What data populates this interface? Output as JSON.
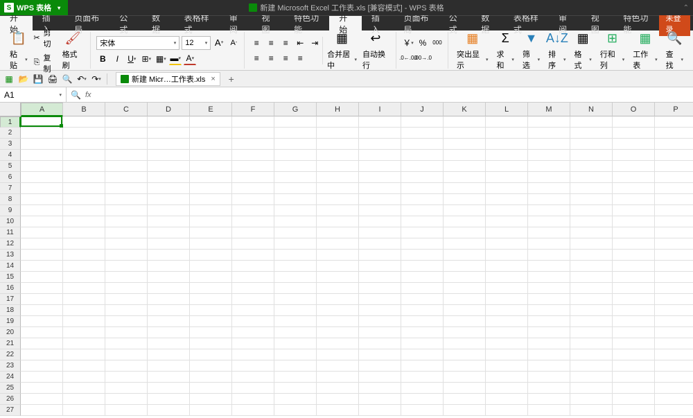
{
  "app": {
    "brand": "WPS 表格",
    "doc_title": "新建 Microsoft Excel 工作表.xls [兼容模式] - WPS 表格"
  },
  "menubar": {
    "items": [
      "开始",
      "插入",
      "页面布局",
      "公式",
      "数据",
      "表格样式",
      "审阅",
      "视图",
      "特色功能"
    ],
    "active_index": 0,
    "login_label": "未登录"
  },
  "ribbon": {
    "paste_label": "粘贴",
    "cut_label": "剪切",
    "copy_label": "复制",
    "brush_label": "格式刷",
    "font_name": "宋体",
    "font_size": "12",
    "merge_center_label": "合并居中",
    "wrap_text_label": "自动换行",
    "currency_symbol": "￥",
    "percent_symbol": "%",
    "comma_symbol": "000",
    "increase_dec": ".0→.00",
    "decrease_dec": ".00→.0",
    "highlight_label": "突出显示",
    "sum_label": "求和",
    "filter_label": "筛选",
    "sort_label": "排序",
    "format_label": "格式",
    "rowcol_label": "行和列",
    "sheet_label": "工作表",
    "find_label": "查找"
  },
  "filetab": {
    "label": "新建 Micr…工作表.xls"
  },
  "formula": {
    "name_box": "A1",
    "fx": "fx"
  },
  "grid": {
    "columns": [
      "A",
      "B",
      "C",
      "D",
      "E",
      "F",
      "G",
      "H",
      "I",
      "J",
      "K",
      "L",
      "M",
      "N",
      "O",
      "P"
    ],
    "rows": 27,
    "active_col": 0,
    "active_row": 0
  }
}
